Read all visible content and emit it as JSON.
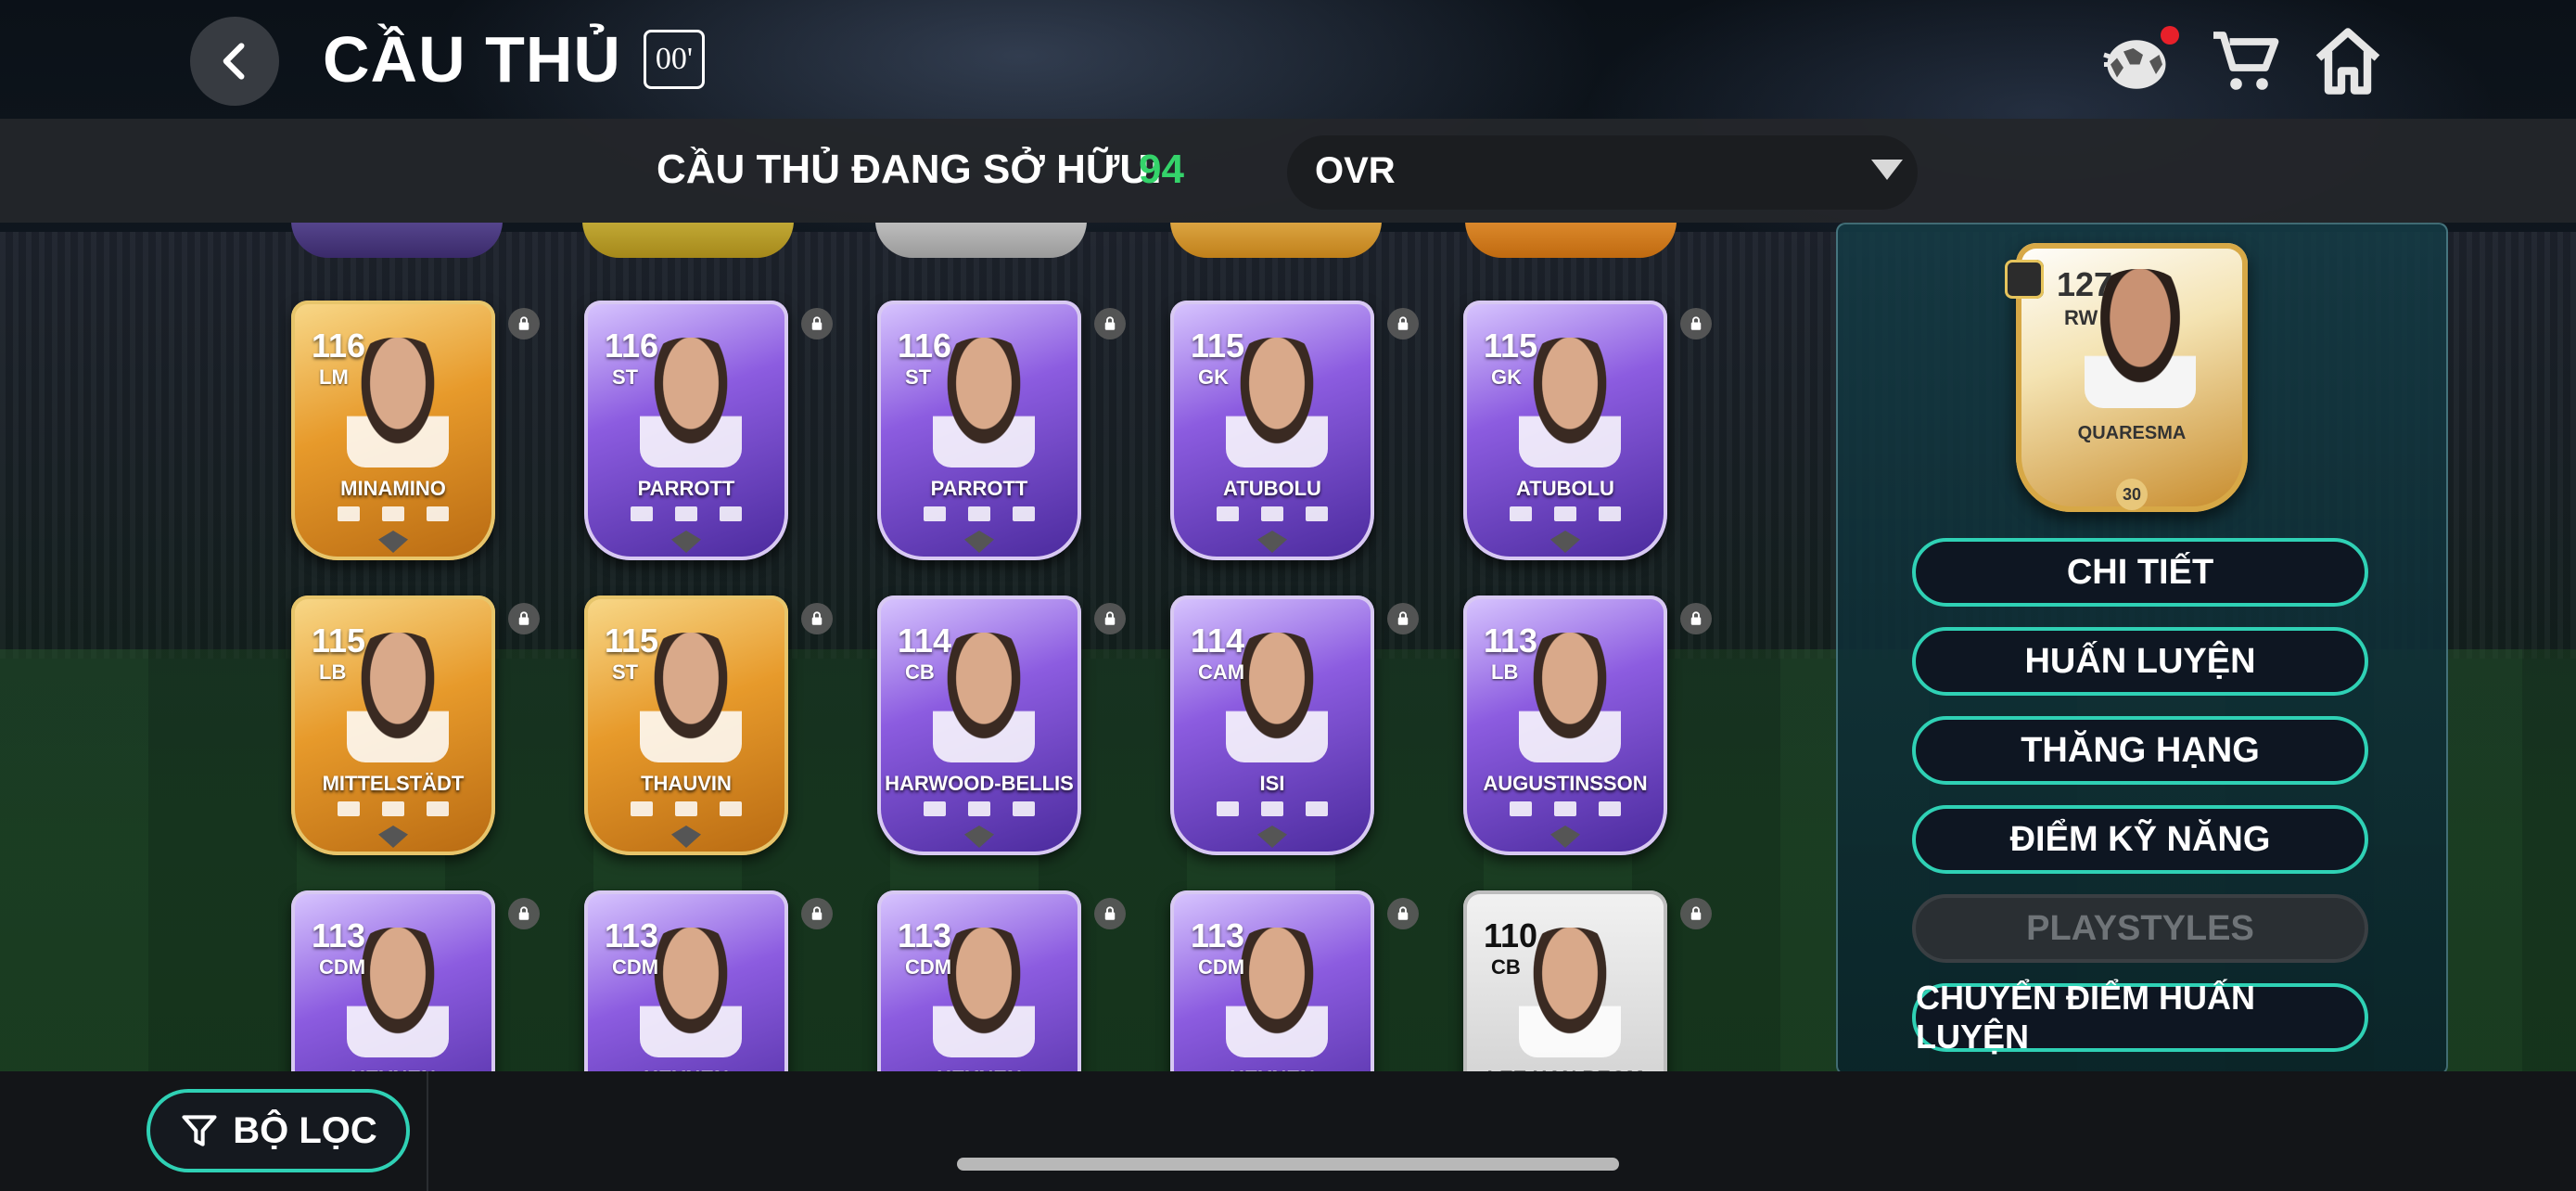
{
  "header": {
    "title": "CẦU THỦ",
    "season_badge": "00'"
  },
  "subheader": {
    "owned_label": "CẦU THỦ ĐANG SỞ HỮU:",
    "owned_count": "94",
    "sort_value": "OVR"
  },
  "cards": [
    {
      "ovr": "116",
      "pos": "LM",
      "name": "MINAMINO",
      "style": "gold"
    },
    {
      "ovr": "116",
      "pos": "ST",
      "name": "PARROTT",
      "style": "purple"
    },
    {
      "ovr": "116",
      "pos": "ST",
      "name": "PARROTT",
      "style": "purple"
    },
    {
      "ovr": "115",
      "pos": "GK",
      "name": "ATUBOLU",
      "style": "purple"
    },
    {
      "ovr": "115",
      "pos": "GK",
      "name": "ATUBOLU",
      "style": "purple"
    },
    {
      "ovr": "115",
      "pos": "LB",
      "name": "MITTELSTÄDT",
      "style": "gold"
    },
    {
      "ovr": "115",
      "pos": "ST",
      "name": "THAUVIN",
      "style": "gold"
    },
    {
      "ovr": "114",
      "pos": "CB",
      "name": "HARWOOD-BELLIS",
      "style": "purple"
    },
    {
      "ovr": "114",
      "pos": "CAM",
      "name": "ISI",
      "style": "purple"
    },
    {
      "ovr": "113",
      "pos": "LB",
      "name": "AUGUSTINSSON",
      "style": "purple"
    },
    {
      "ovr": "113",
      "pos": "CDM",
      "name": "HEYNEN",
      "style": "purple"
    },
    {
      "ovr": "113",
      "pos": "CDM",
      "name": "HEYNEN",
      "style": "purple"
    },
    {
      "ovr": "113",
      "pos": "CDM",
      "name": "HEYNEN",
      "style": "purple"
    },
    {
      "ovr": "113",
      "pos": "CDM",
      "name": "HEYNEN",
      "style": "purple"
    },
    {
      "ovr": "110",
      "pos": "CB",
      "name": "LEE HAN BEOM",
      "style": "white"
    }
  ],
  "featured": {
    "ovr": "127",
    "pos": "RW",
    "name": "QUARESMA",
    "badge": "30"
  },
  "actions": {
    "details": "CHI TIẾT",
    "training": "HUẤN LUYỆN",
    "promote": "THĂNG HẠNG",
    "skill_points": "ĐIỂM KỸ NĂNG",
    "playstyles": "PLAYSTYLES",
    "transfer_training": "CHUYỂN ĐIỂM HUẤN LUYỆN"
  },
  "bottom": {
    "filter_label": "BỘ LỌC"
  },
  "colors": {
    "accent": "#2fd1b5",
    "owned_count": "#34d36a",
    "notification": "#e8202a"
  },
  "icons": [
    "back-icon",
    "ball-icon",
    "cart-icon",
    "home-icon",
    "lock-icon",
    "filter-icon",
    "dropdown-arrow-icon"
  ]
}
